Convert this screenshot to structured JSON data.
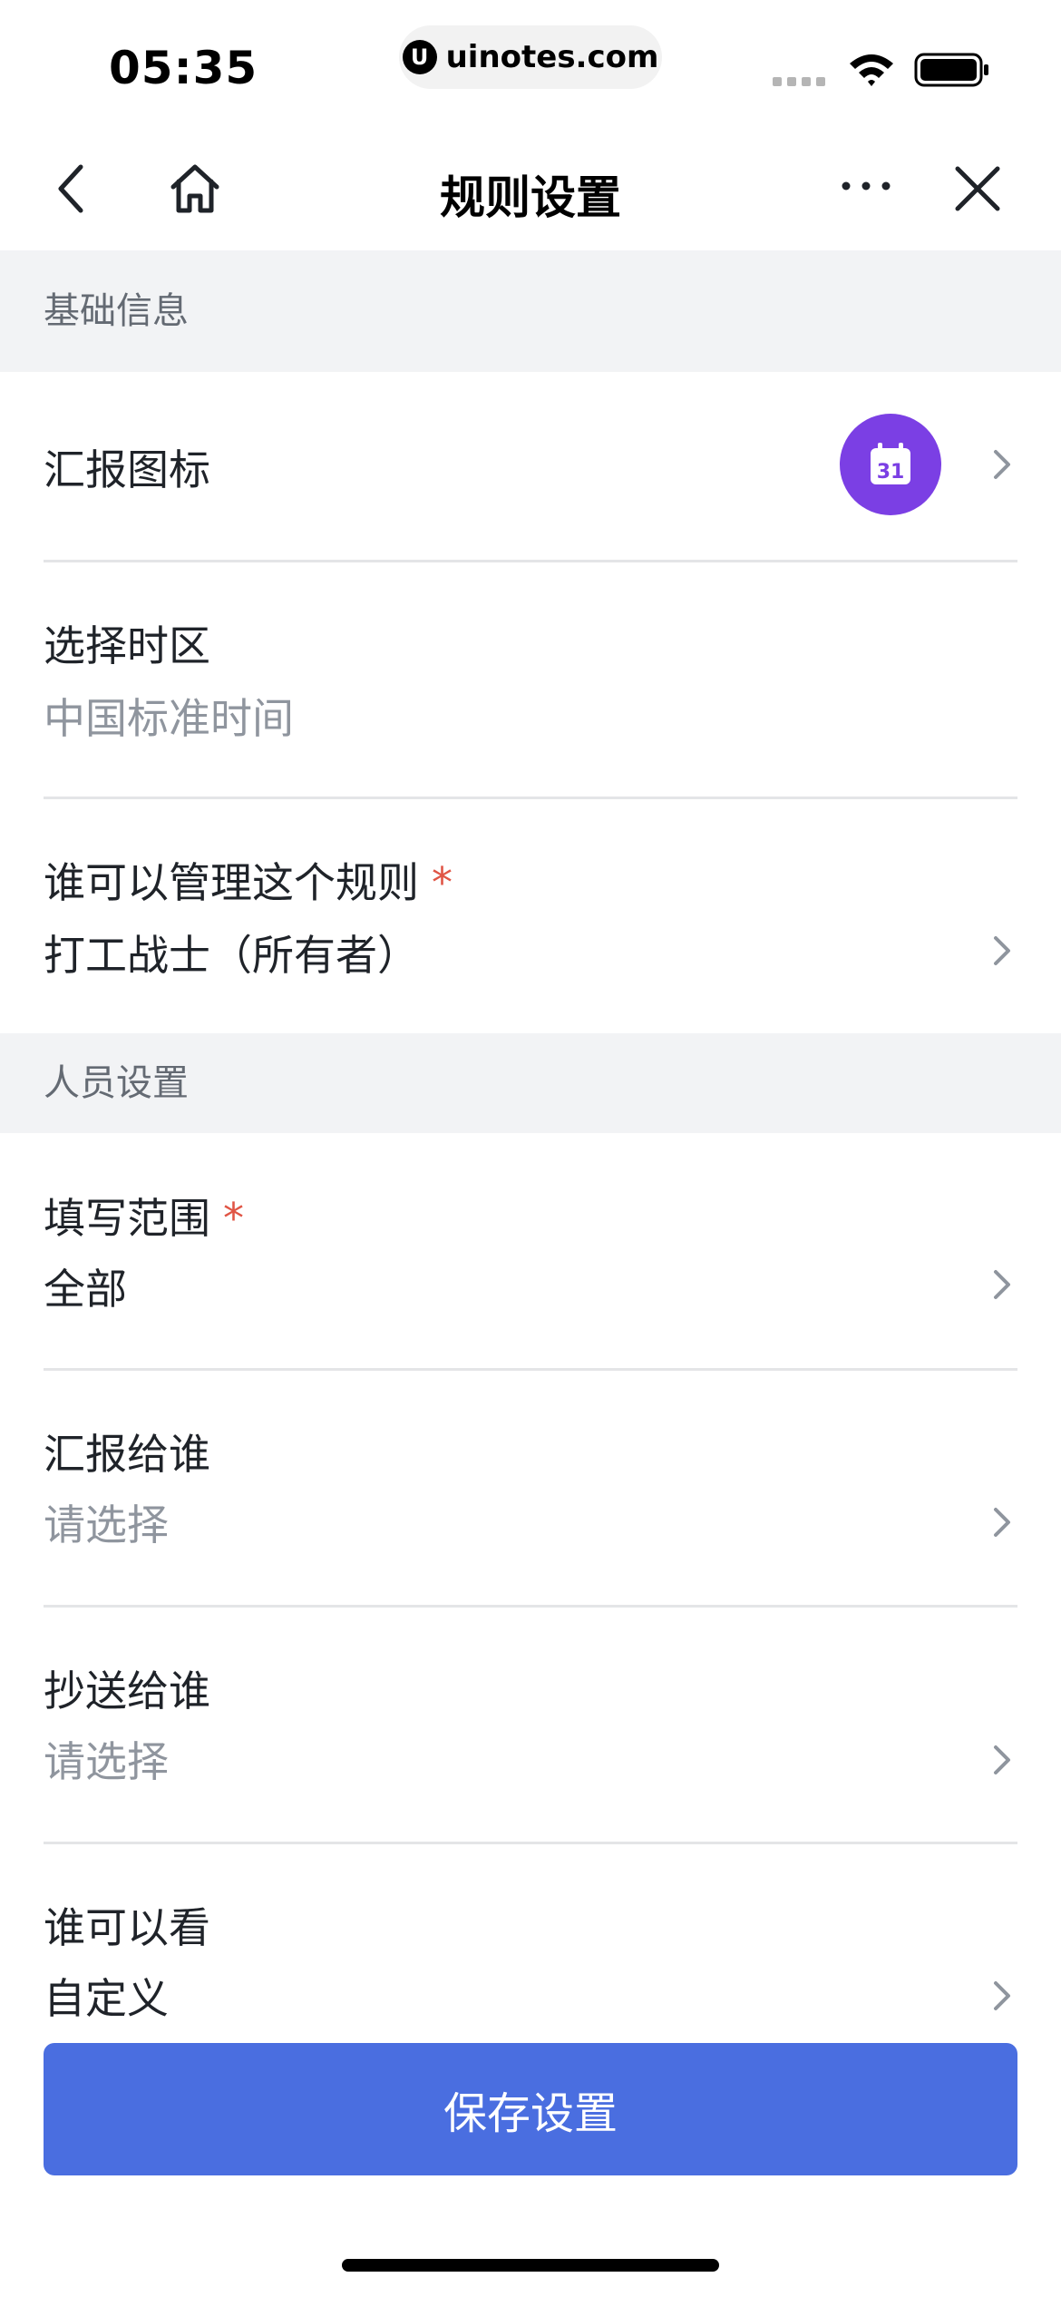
{
  "status_bar": {
    "time": "05:35",
    "url": "uinotes.com",
    "url_logo": "U"
  },
  "nav": {
    "title": "规则设置",
    "icons": [
      "back-icon",
      "home-icon",
      "more-icon",
      "close-icon"
    ]
  },
  "sections": {
    "basic": "基础信息",
    "people": "人员设置"
  },
  "rows": {
    "report_icon": {
      "label": "汇报图标",
      "icon": "calendar-icon",
      "icon_text": "31",
      "icon_color": "#7b3fe4"
    },
    "timezone": {
      "label": "选择时区",
      "value": "中国标准时间"
    },
    "manager": {
      "label": "谁可以管理这个规则",
      "required": "*",
      "value": "打工战士（所有者）"
    },
    "scope": {
      "label": "填写范围",
      "required": "*",
      "value": "全部"
    },
    "report_to": {
      "label": "汇报给谁",
      "value": "请选择"
    },
    "cc_to": {
      "label": "抄送给谁",
      "value": "请选择"
    },
    "visible_to": {
      "label": "谁可以看",
      "value": "自定义"
    }
  },
  "save_button": {
    "label": "保存设置",
    "color": "#4a6ee0"
  }
}
